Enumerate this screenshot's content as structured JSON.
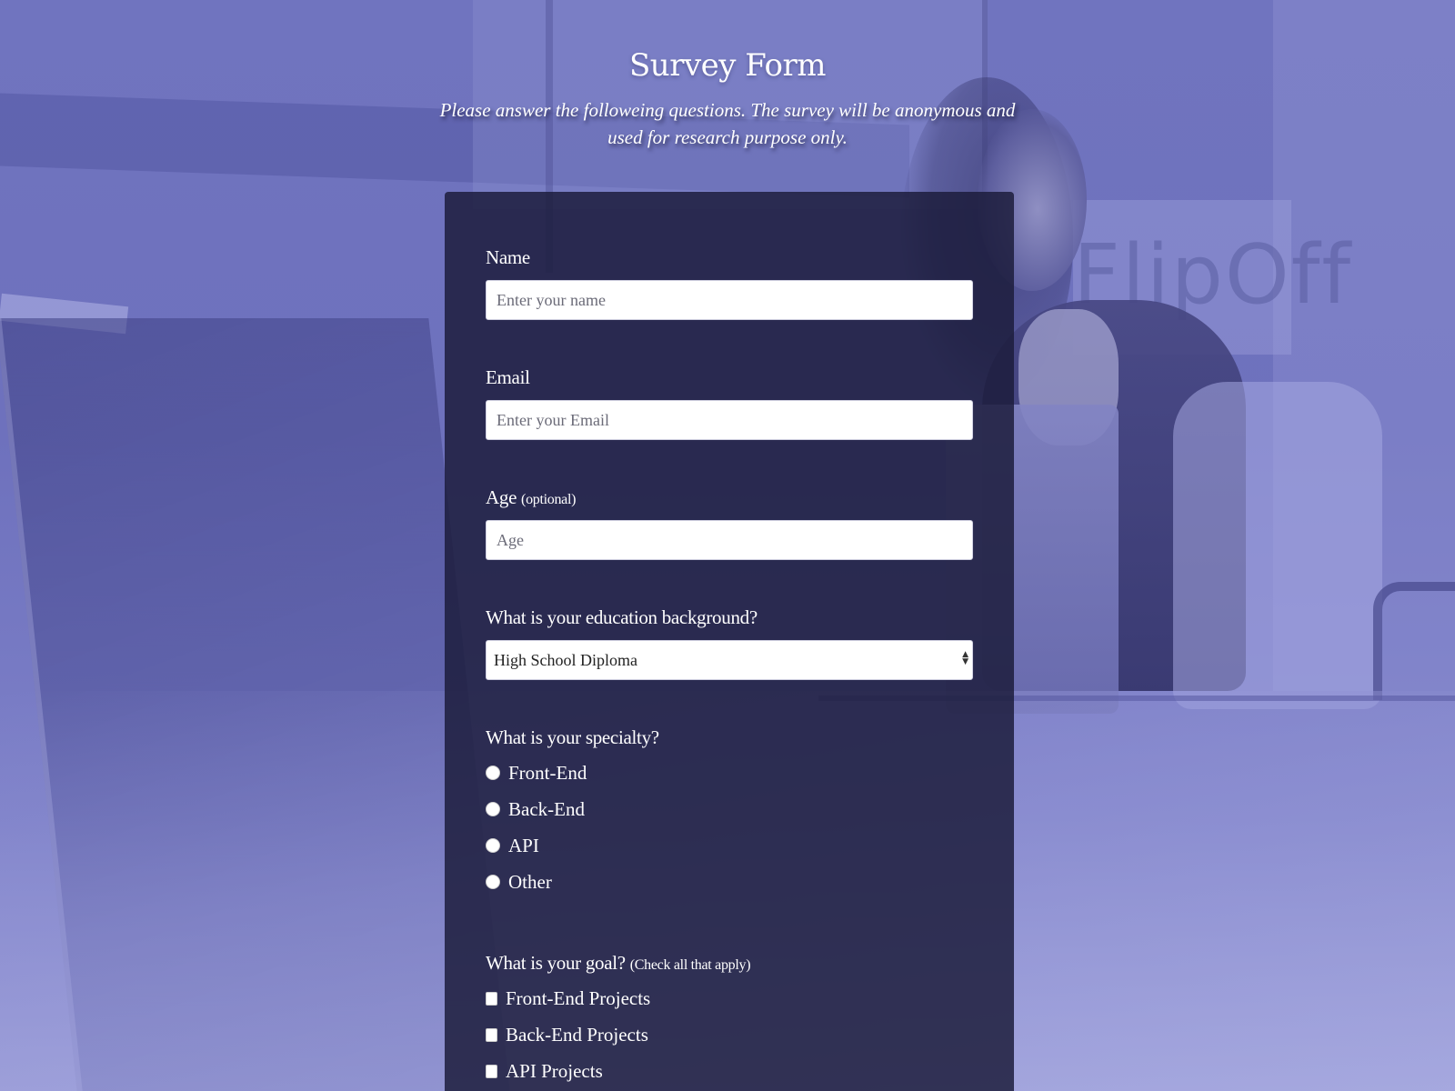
{
  "header": {
    "title": "Survey Form",
    "description": "Please answer the followeing questions. The survey will be anonymous and used for research purpose only."
  },
  "form": {
    "name": {
      "label": "Name",
      "placeholder": "Enter your name",
      "value": ""
    },
    "email": {
      "label": "Email",
      "placeholder": "Enter your Email",
      "value": ""
    },
    "age": {
      "label": "Age",
      "clue": "(optional)",
      "placeholder": "Age",
      "value": ""
    },
    "education": {
      "label": "What is your education background?",
      "selected": "High School Diploma"
    },
    "specialty": {
      "label": "What is your specialty?",
      "options": [
        "Front-End",
        "Back-End",
        "API",
        "Other"
      ]
    },
    "goal": {
      "label": "What is your goal?",
      "clue": "(Check all that apply)",
      "options": [
        "Front-End Projects",
        "Back-End Projects",
        "API Projects"
      ]
    }
  },
  "background": {
    "banner_text": "FlipOff",
    "tint_color": "#6f72c2",
    "card_color": "#1b1c3a"
  }
}
